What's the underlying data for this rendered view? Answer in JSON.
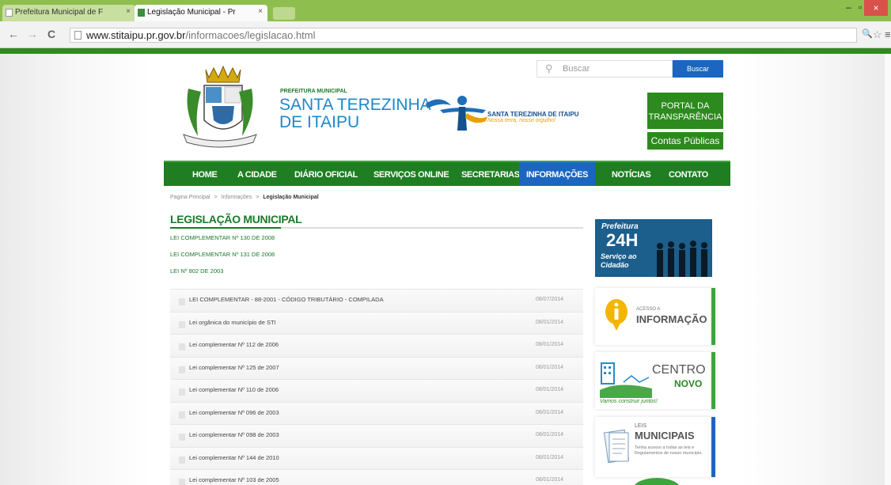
{
  "browser": {
    "tabs": [
      {
        "title": "Prefeitura Municipal de F"
      },
      {
        "title": "Legislação Municipal - Pr"
      }
    ],
    "tab_close": "×",
    "url_host": "www.stitaipu.pr.gov.br",
    "url_path": "/informacoes/legislacao.html",
    "back": "←",
    "forward": "→",
    "reload": "C",
    "minimize": "–",
    "maximize": "▫",
    "close": "×",
    "zoom_icon": "🔍",
    "star_icon": "☆",
    "menu_icon": "≡"
  },
  "header": {
    "search_placeholder": "Buscar",
    "search_button": "Buscar",
    "pref_small": "PREFEITURA MUNICIPAL",
    "pref_line1": "SANTA TEREZINHA",
    "pref_line2": "DE ITAIPU",
    "sti_name": "SANTA TEREZINHA DE ITAIPU",
    "sti_slogan": "Nossa terra, nosso orgulho!",
    "portal_line1": "PORTAL DA",
    "portal_line2": "TRANSPARÊNCIA",
    "contas": "Contas Públicas"
  },
  "menu": {
    "home": "HOME",
    "cidade": "A CIDADE",
    "diario": "DIÁRIO OFICIAL",
    "servicos": "SERVIÇOS ONLINE",
    "secretarias": "SECRETARIAS",
    "informacoes": "INFORMAÇÕES",
    "noticias": "NOTÍCIAS",
    "contato": "CONTATO"
  },
  "breadcrumb": {
    "home": "Pagina Principal",
    "sep": ">",
    "section": "Informações",
    "current": "Legislação Municipal"
  },
  "page_title": "LEGISLAÇÃO MUNICIPAL",
  "laws": [
    "LEI COMPLEMENTAR Nº 130 DE 2008",
    "LEI COMPLEMENTAR Nº 131 DE 2008",
    "LEI Nº 802 DE 2003"
  ],
  "documents": [
    {
      "name": "LEI COMPLEMENTAR - 88-2001 - CÓDIGO TRIBUTÁRIO - COMPILADA",
      "date": "08/07/2014"
    },
    {
      "name": "Lei orgânica do município de STI",
      "date": "08/01/2014"
    },
    {
      "name": "Lei complementar Nº 112 de 2006",
      "date": "08/01/2014"
    },
    {
      "name": "Lei complementar Nº 125 de 2007",
      "date": "08/01/2014"
    },
    {
      "name": "Lei complementar Nº 110 de 2006",
      "date": "08/01/2014"
    },
    {
      "name": "Lei complementar Nº 096 de 2003",
      "date": "08/01/2014"
    },
    {
      "name": "Lei complementar Nº 098 de 2003",
      "date": "08/01/2014"
    },
    {
      "name": "Lei complementar Nº 144 de 2010",
      "date": "08/01/2014"
    },
    {
      "name": "Lei complementar Nº 103 de 2005",
      "date": "08/01/2014"
    }
  ],
  "sidebar": {
    "b24_top": "Prefeitura",
    "b24_mid": "24H",
    "b24_bot1": "Serviço ao",
    "b24_bot2": "Cidadão",
    "acesso_small": "ACESSO A",
    "acesso_big": "INFORMAÇÃO",
    "centro_1": "CENTRO",
    "centro_2": "NOVO",
    "centro_3": "Vamos construir juntos!",
    "leis_small": "LEIS",
    "leis_big": "MUNICIPAIS",
    "leis_desc": "Tenha acesso a todas as leis e Regulamentos de nosso município."
  }
}
